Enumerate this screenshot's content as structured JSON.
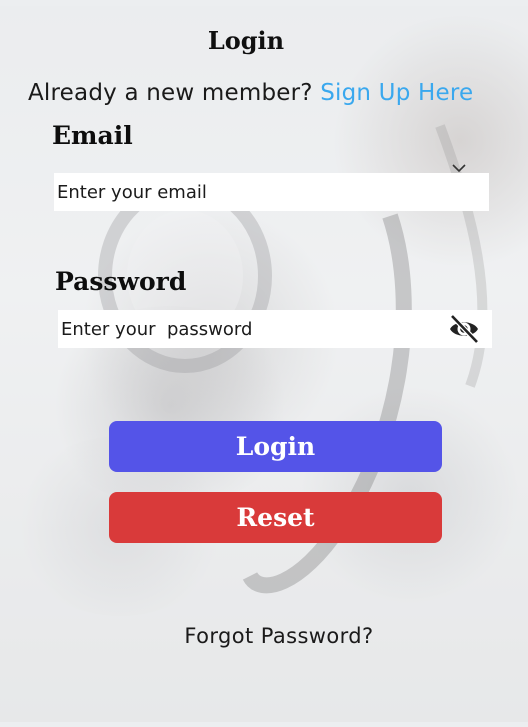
{
  "login_form": {
    "title": "Login",
    "signup_prompt": "Already a new member?",
    "signup_link": "Sign Up Here",
    "email": {
      "label": "Email",
      "placeholder": "Enter your email",
      "value": ""
    },
    "password": {
      "label": "Password",
      "placeholder": "Enter your  password",
      "value": "",
      "visibility_icon": "eye-off-icon"
    },
    "email_dropdown_icon": "chevron-down-icon",
    "login_button": "Login",
    "reset_button": "Reset",
    "forgot_password": "Forgot Password?"
  },
  "colors": {
    "login_button": "#5454e8",
    "reset_button": "#d93a3a",
    "link": "#3aa8ee"
  }
}
